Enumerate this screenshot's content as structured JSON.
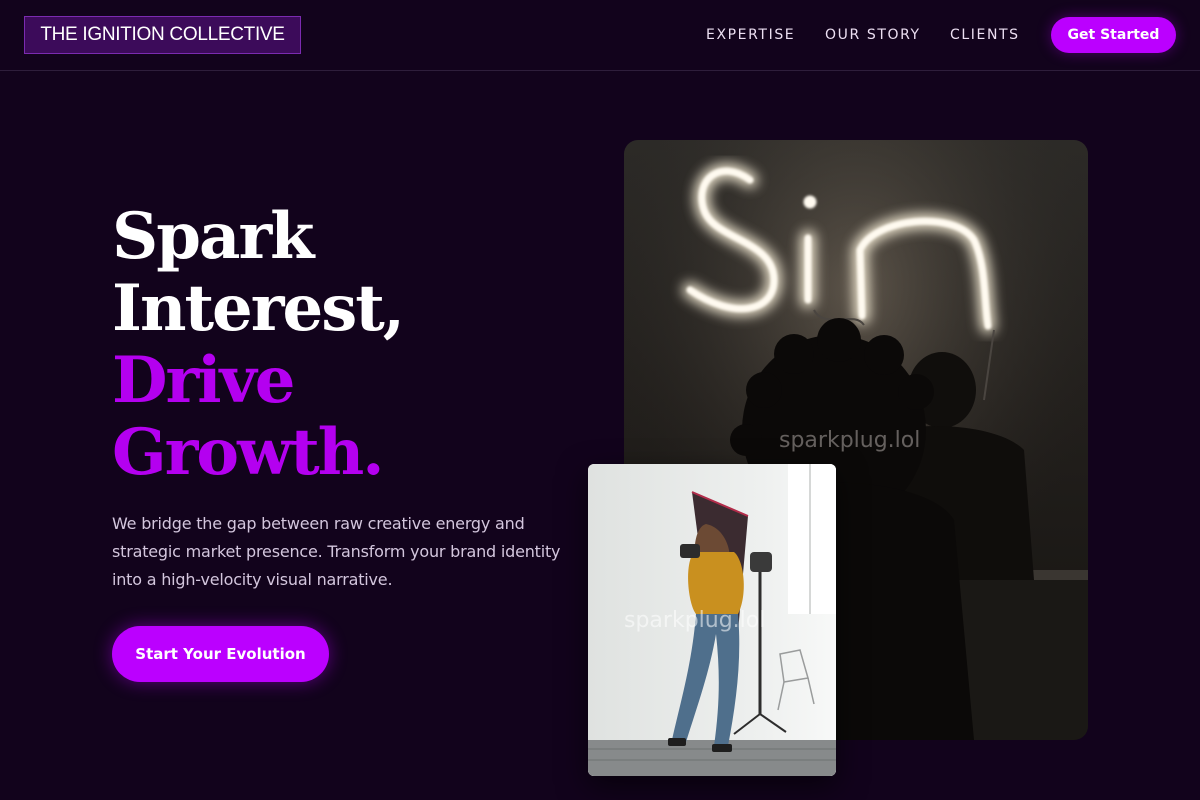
{
  "brand": {
    "logo_text": "THE IGNITION COLLECTIVE"
  },
  "nav": {
    "items": [
      {
        "label": "EXPERTISE"
      },
      {
        "label": "OUR STORY"
      },
      {
        "label": "CLIENTS"
      }
    ],
    "cta_label": "Get Started"
  },
  "hero": {
    "headline": {
      "line1": "Spark",
      "line2": "Interest,",
      "line3": "Drive",
      "line4": "Growth."
    },
    "description": "We bridge the gap between raw creative energy and strategic market presence. Transform your brand identity into a high-velocity visual narrative.",
    "cta_label": "Start Your Evolution"
  },
  "media": {
    "main_photo": {
      "neon_sign_text": "Sin",
      "watermark": "sparkplug.lol"
    },
    "small_photo": {
      "watermark": "sparkplug.lol"
    }
  },
  "colors": {
    "background": "#12031c",
    "accent": "#bb00ff",
    "headline_accent": "#b400f0",
    "logo_bg": "#3c0b5a"
  }
}
